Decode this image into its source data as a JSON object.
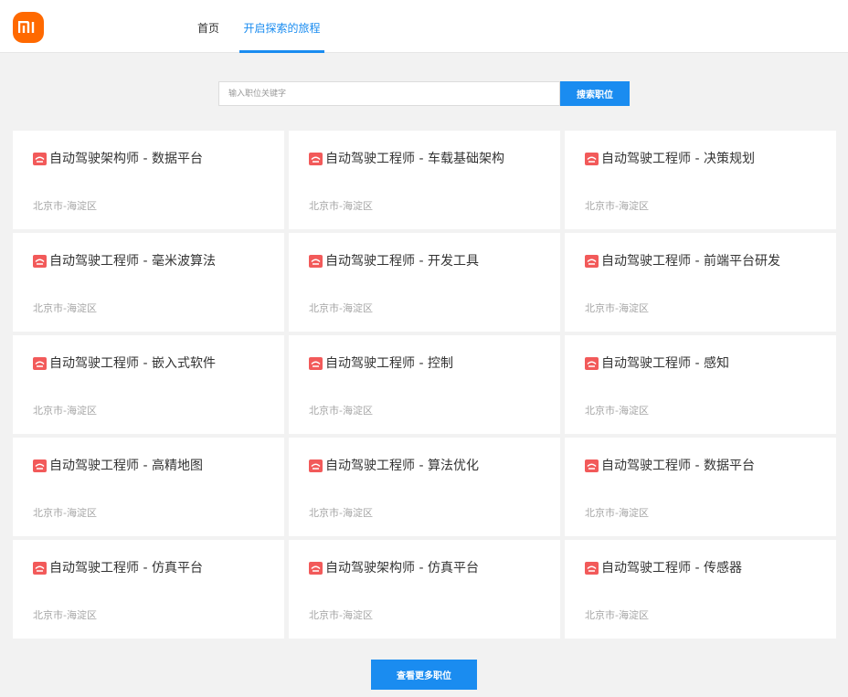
{
  "brand": {
    "logo_text": "mi",
    "icon": "xiaomi-logo-icon",
    "color": "#ff6900"
  },
  "nav": {
    "home": "首页",
    "journey": "开启探索的旅程"
  },
  "search": {
    "placeholder": "输入职位关键字",
    "button": "搜索职位"
  },
  "accent_color": "#1a8cf0",
  "jobs": [
    {
      "title": "自动驾驶架构师 - 数据平台",
      "location": "北京市-海淀区"
    },
    {
      "title": "自动驾驶工程师 - 车载基础架构",
      "location": "北京市-海淀区"
    },
    {
      "title": "自动驾驶工程师 - 决策规划",
      "location": "北京市-海淀区"
    },
    {
      "title": "自动驾驶工程师 - 毫米波算法",
      "location": "北京市-海淀区"
    },
    {
      "title": "自动驾驶工程师 - 开发工具",
      "location": "北京市-海淀区"
    },
    {
      "title": "自动驾驶工程师 - 前端平台研发",
      "location": "北京市-海淀区"
    },
    {
      "title": "自动驾驶工程师 - 嵌入式软件",
      "location": "北京市-海淀区"
    },
    {
      "title": "自动驾驶工程师 - 控制",
      "location": "北京市-海淀区"
    },
    {
      "title": "自动驾驶工程师 - 感知",
      "location": "北京市-海淀区"
    },
    {
      "title": "自动驾驶工程师 - 高精地图",
      "location": "北京市-海淀区"
    },
    {
      "title": "自动驾驶工程师 - 算法优化",
      "location": "北京市-海淀区"
    },
    {
      "title": "自动驾驶工程师 - 数据平台",
      "location": "北京市-海淀区"
    },
    {
      "title": "自动驾驶工程师 - 仿真平台",
      "location": "北京市-海淀区"
    },
    {
      "title": "自动驾驶架构师 - 仿真平台",
      "location": "北京市-海淀区"
    },
    {
      "title": "自动驾驶工程师 - 传感器",
      "location": "北京市-海淀区"
    }
  ],
  "more_button": "查看更多职位"
}
